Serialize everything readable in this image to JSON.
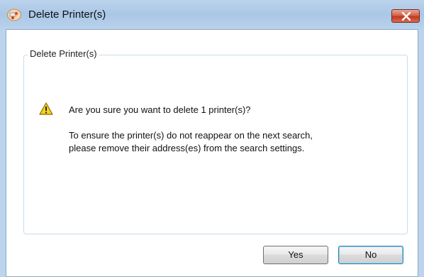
{
  "window": {
    "title": "Delete Printer(s)",
    "title_icon": "printers-icon",
    "close_icon": "close-icon"
  },
  "dialog": {
    "group_label": "Delete Printer(s)",
    "warning_icon": "warning-icon",
    "question": "Are you sure you want to delete 1 printer(s)?",
    "info_line1": "To ensure the printer(s) do not reappear on the next search,",
    "info_line2": "please remove their address(es) from the search settings."
  },
  "buttons": {
    "yes_label": "Yes",
    "no_label": "No"
  },
  "colors": {
    "title_bar": "#bcd3ec",
    "close_button": "#c0391f",
    "default_button_border": "#3c7fb1"
  }
}
